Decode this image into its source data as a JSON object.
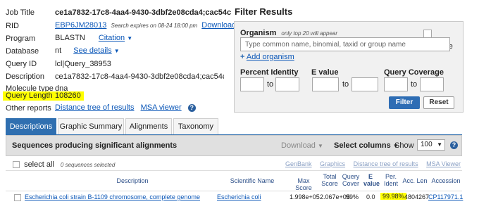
{
  "job": {
    "job_title_label": "Job Title",
    "job_title_value": "ce1a7832-17c8-4aa4-9430-3dbf2e08cda4;cac54c68-a16d-46",
    "rid_label": "RID",
    "rid_value": "EBP6JM28013",
    "rid_note": "Search expires on 08-24 18:00 pm",
    "download_all": "Download All",
    "program_label": "Program",
    "program_value": "BLASTN",
    "citation": "Citation",
    "database_label": "Database",
    "database_value": "nt",
    "see_details": "See details",
    "query_id_label": "Query ID",
    "query_id_value": "lcl|Query_38953",
    "description_label": "Description",
    "description_value": "ce1a7832-17c8-4aa4-9430-3dbf2e08cda4;cac54c68-a16d-46",
    "molecule_label": "Molecule type",
    "molecule_value": "dna",
    "query_length_label": "Query Length",
    "query_length_value": "108260",
    "other_reports_label": "Other reports",
    "distance_tree": "Distance tree of results",
    "msa_viewer": "MSA viewer"
  },
  "filter": {
    "title": "Filter Results",
    "organism_label": "Organism",
    "organism_note": "only top 20 will appear",
    "exclude_label": "exclude",
    "organism_placeholder": "Type common  name, binomial, taxid or group  name",
    "add_organism": "Add organism",
    "percent_identity_label": "Percent Identity",
    "evalue_label": "E value",
    "query_coverage_label": "Query Coverage",
    "to1": "to",
    "to2": "to",
    "to3": "to",
    "filter_button": "Filter",
    "reset_button": "Reset"
  },
  "tabs": [
    "Descriptions",
    "Graphic Summary",
    "Alignments",
    "Taxonomy"
  ],
  "results": {
    "title": "Sequences producing significant alignments",
    "download": "Download",
    "select_columns": "Select columns",
    "show_label": "Show",
    "show_value": "100",
    "select_all": "select all",
    "selected_count": "0 sequences selected",
    "actions": [
      "GenBank",
      "Graphics",
      "Distance tree of results",
      "MSA Viewer"
    ],
    "columns": [
      "Description",
      "Scientific Name",
      "Max Score",
      "Total Score",
      "Query Cover",
      "E value",
      "Per. Ident",
      "Acc. Len",
      "Accession"
    ],
    "rows": [
      {
        "description": "Escherichia coli strain B-1109 chromosome, complete genome",
        "scientific_name": "Escherichia coli",
        "max_score": "1.998e+05",
        "total_score": "2.067e+05",
        "query_cover": "99%",
        "evalue": "0.0",
        "per_ident": "99.98%",
        "acc_len": "4804267",
        "accession": "CP117971.1"
      }
    ]
  },
  "colors": {
    "accent": "#2f6fb0",
    "link": "#0b57b8",
    "highlight": "#ffff00"
  }
}
